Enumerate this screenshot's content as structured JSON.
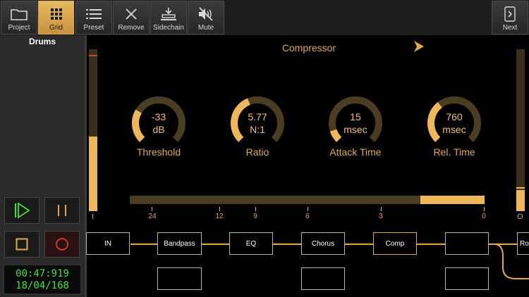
{
  "toolbar": {
    "buttons": [
      {
        "label": "Project",
        "icon": "folder-icon"
      },
      {
        "label": "Grid",
        "icon": "grid-icon",
        "active": true
      },
      {
        "label": "Preset",
        "icon": "list-icon"
      },
      {
        "label": "Remove",
        "icon": "close-icon"
      },
      {
        "label": "Sidechain",
        "icon": "sidechain-icon"
      },
      {
        "label": "Mute",
        "icon": "speaker-mute-icon"
      }
    ],
    "next_label": "Next"
  },
  "track": {
    "name": "Drums",
    "time": "00:47:919",
    "bars": "18/04/168"
  },
  "effect": {
    "name": "Compressor",
    "input_meter": {
      "label": "I",
      "level": 0.46
    },
    "output_meter": {
      "label": "O",
      "level": 0.13
    },
    "knobs": [
      {
        "label": "Threshold",
        "value": "-33",
        "unit": "dB",
        "fraction": 0.28
      },
      {
        "label": "Ratio",
        "value": "5.77",
        "unit": "N:1",
        "fraction": 0.42
      },
      {
        "label": "Attack Time",
        "value": "15",
        "unit": "msec",
        "fraction": 0.1
      },
      {
        "label": "Rel. Time",
        "value": "760",
        "unit": "msec",
        "fraction": 0.36
      }
    ],
    "gain_reduction": {
      "ticks": [
        "24",
        "12",
        "9",
        "6",
        "3",
        "0"
      ],
      "reduction_fraction": 0.18
    }
  },
  "chain": {
    "nodes": [
      "IN",
      "Bandpass",
      "EQ",
      "Chorus",
      "Comp",
      "",
      "Ro"
    ],
    "selected": "Comp"
  },
  "colors": {
    "accent": "#e0a94a",
    "accent_bright": "#eeb75a",
    "track_dim": "#4a3d22",
    "time_green": "#3ce23c"
  }
}
